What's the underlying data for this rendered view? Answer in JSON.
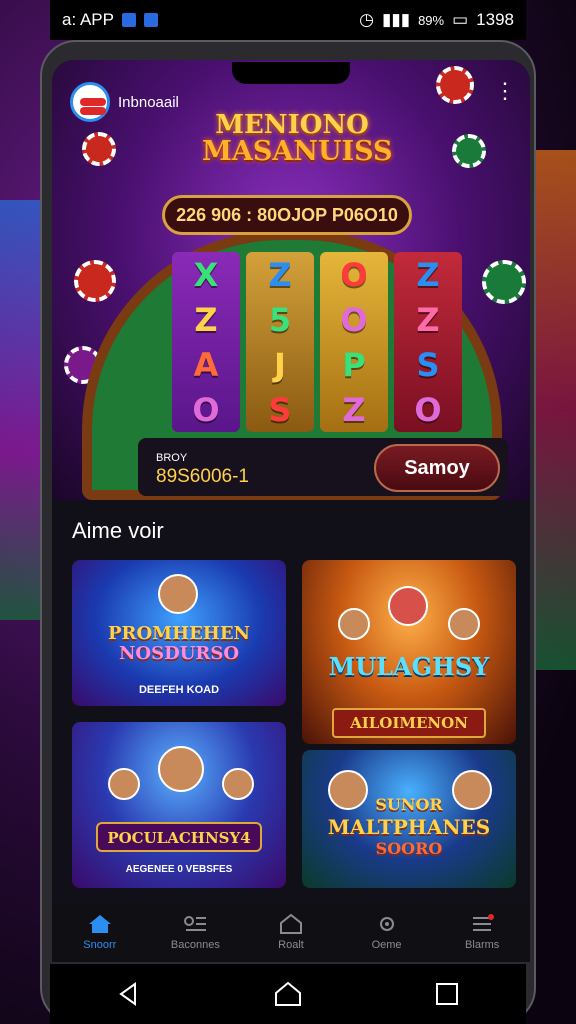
{
  "status_bar": {
    "left_text": "a: APP",
    "right_text": "89%",
    "time": "1398"
  },
  "app": {
    "logo_text": "Inbnoaail"
  },
  "hero": {
    "title_line1": "MENIONO",
    "title_line2": "MASANUISS",
    "title_sub": "",
    "jackpot_text": "226 906 : 80OJOP P06O10",
    "reels": [
      [
        "X",
        "Z",
        "A",
        "O"
      ],
      [
        "Z",
        "5",
        "J",
        "S"
      ],
      [
        "O",
        "O",
        "P",
        "Z"
      ],
      [
        "Z",
        "Z",
        "S",
        "O"
      ]
    ],
    "bet_label": "BROY",
    "bet_value": "89S6006-1",
    "spin_label": "Samoy"
  },
  "section": {
    "title": "Aime voir"
  },
  "games": [
    {
      "title_line1": "PROMHEHEN",
      "title_line2": "NOSDURSO",
      "caption": "DEEFEH KOAD"
    },
    {
      "title": "MULAGHSY",
      "caption": "AILOIMENON"
    },
    {
      "title": "POCULACHNSY4",
      "caption": "AEGENEE 0 VEBSFES"
    },
    {
      "title_line1": "SUNOR",
      "title_line2": "MALTPHANES",
      "title_line3": "SOORO"
    }
  ],
  "bottom_nav": [
    {
      "label": "Snoorr",
      "icon": "home-icon"
    },
    {
      "label": "Baconnes",
      "icon": "list-icon"
    },
    {
      "label": "Roalt",
      "icon": "house-outline-icon"
    },
    {
      "label": "Oeme",
      "icon": "settings-gear-icon"
    },
    {
      "label": "Blarms",
      "icon": "menu-icon"
    }
  ],
  "colors": {
    "accent": "#2b8ef0",
    "gold": "#ffd24a",
    "hero_purple": "#4a1070"
  }
}
